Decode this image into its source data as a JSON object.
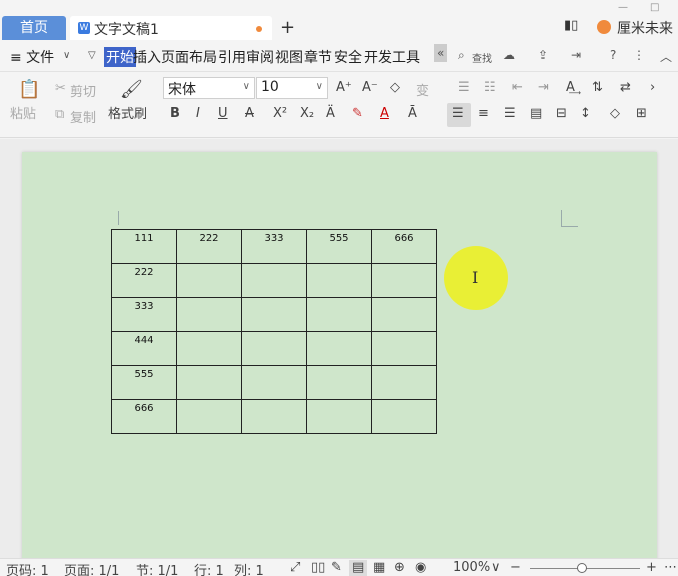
{
  "titlebar": {
    "home_tab": "首页",
    "doc_tab": "文字文稿1",
    "add_tab": "+",
    "user_name": "厘米未来",
    "win_min": "—",
    "win_max": "□"
  },
  "menubar": {
    "file": "≡ 文件",
    "items": [
      "开始",
      "插入",
      "页面布局",
      "引用",
      "审阅",
      "视图",
      "章节",
      "安全",
      "开发工具"
    ],
    "more": "«",
    "search": "查找",
    "help": "?"
  },
  "ribbon": {
    "paste": "粘贴",
    "cut": "剪切",
    "copy": "复制",
    "format_painter": "格式刷",
    "font_name": "宋体",
    "font_size": "10",
    "bold": "B",
    "italic": "I",
    "underline": "U",
    "strike": "A",
    "superscript": "X²",
    "subscript": "X₂",
    "font_grow": "A⁺",
    "font_shrink": "A⁻",
    "clear": "◇",
    "pinyin": "变"
  },
  "table": {
    "rows": [
      [
        "111",
        "222",
        "333",
        "555",
        "666"
      ],
      [
        "222",
        "",
        "",
        "",
        ""
      ],
      [
        "333",
        "",
        "",
        "",
        ""
      ],
      [
        "444",
        "",
        "",
        "",
        ""
      ],
      [
        "555",
        "",
        "",
        "",
        ""
      ],
      [
        "666",
        "",
        "",
        "",
        ""
      ]
    ]
  },
  "statusbar": {
    "page_no": "页码: 1",
    "pages": "页面: 1/1",
    "section": "节: 1/1",
    "row": "行: 1",
    "col": "列: 1",
    "zoom": "100%",
    "zoom_out": "−",
    "zoom_in": "+"
  },
  "colors": {
    "page_bg": "#cfe6cb",
    "accent": "#3e64c9",
    "home_tab": "#5b8fd9",
    "cursor_highlight": "#ebf028"
  }
}
